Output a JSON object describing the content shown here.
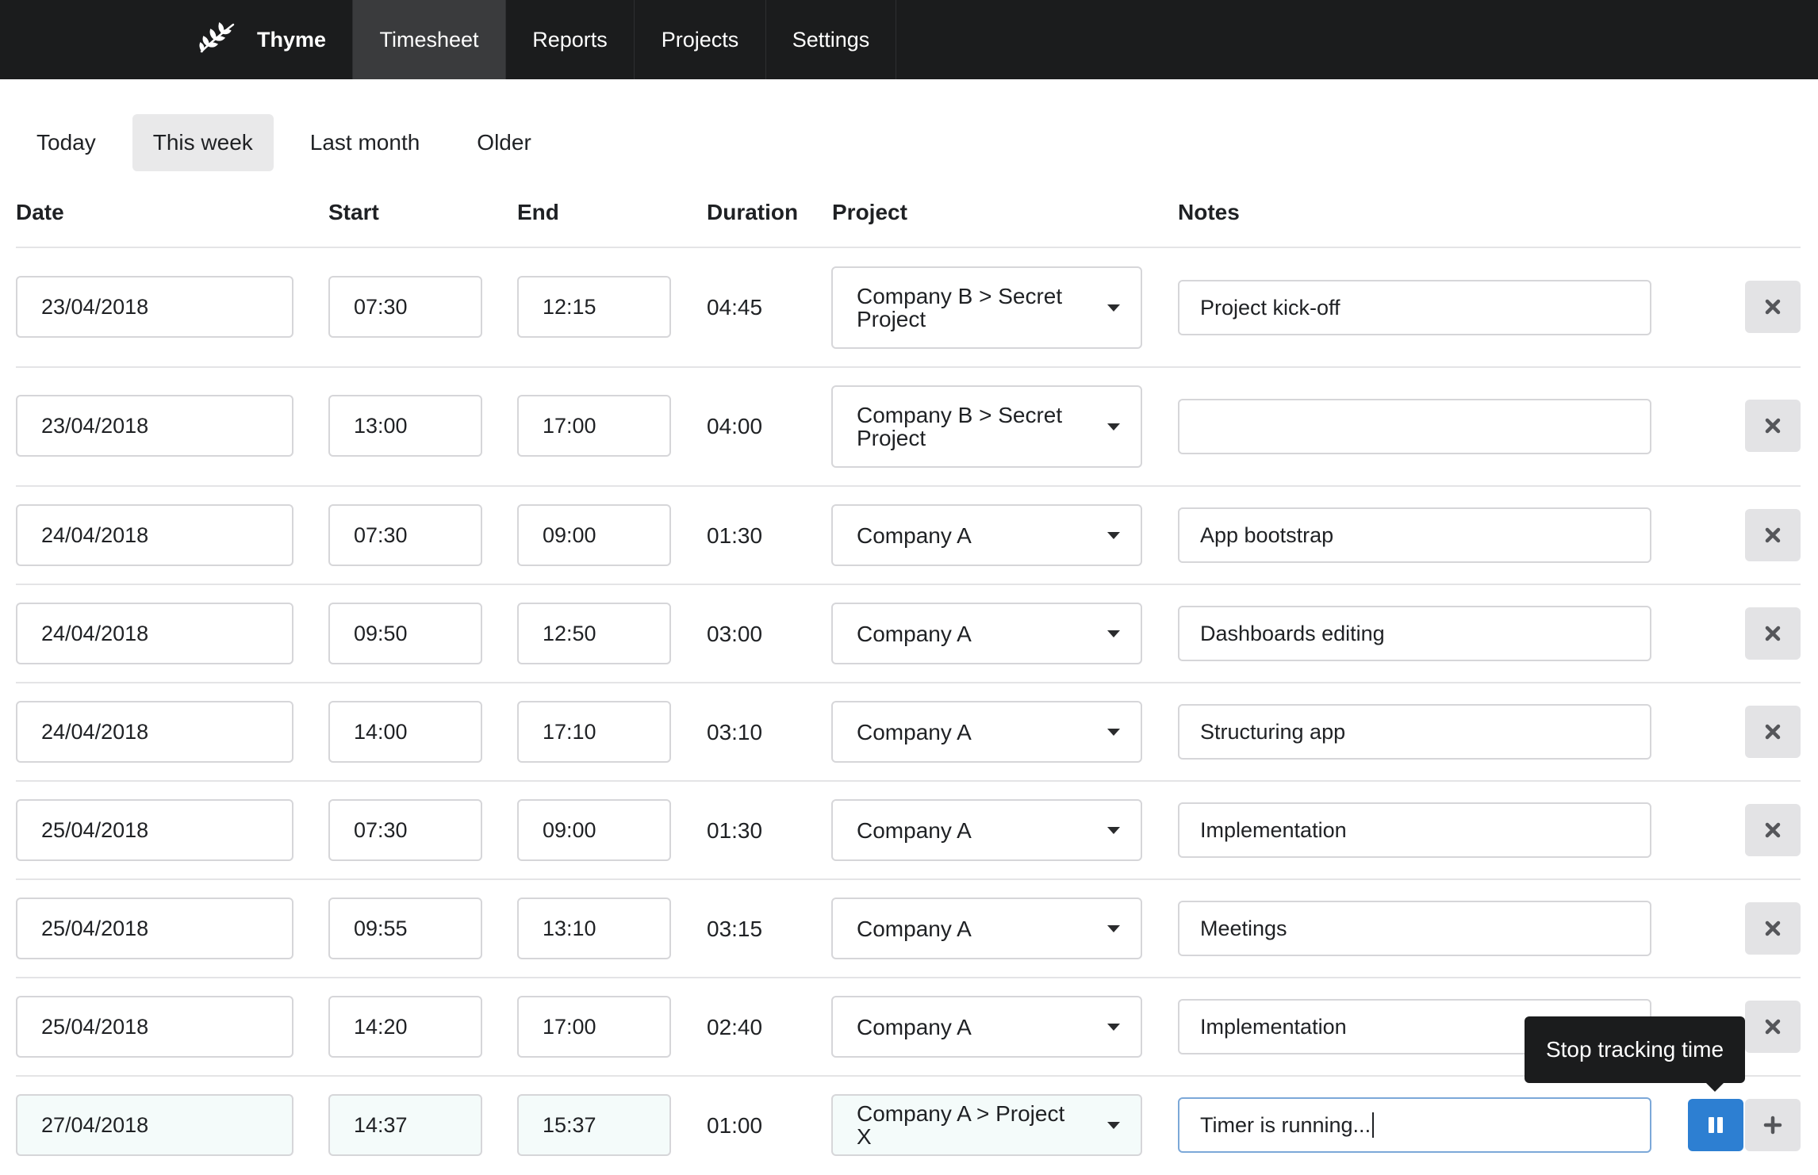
{
  "app": {
    "name": "Thyme",
    "logo_icon": "leaf-sprig-icon"
  },
  "nav": {
    "items": [
      {
        "label": "Timesheet",
        "active": true
      },
      {
        "label": "Reports",
        "active": false
      },
      {
        "label": "Projects",
        "active": false
      },
      {
        "label": "Settings",
        "active": false
      }
    ]
  },
  "filters": {
    "items": [
      {
        "label": "Today",
        "active": false
      },
      {
        "label": "This week",
        "active": true
      },
      {
        "label": "Last month",
        "active": false
      },
      {
        "label": "Older",
        "active": false
      }
    ]
  },
  "table": {
    "headers": {
      "date": "Date",
      "start": "Start",
      "end": "End",
      "duration": "Duration",
      "project": "Project",
      "notes": "Notes"
    },
    "rows": [
      {
        "date": "23/04/2018",
        "start": "07:30",
        "end": "12:15",
        "duration": "04:45",
        "project": "Company B > Secret Project",
        "notes": "Project kick-off"
      },
      {
        "date": "23/04/2018",
        "start": "13:00",
        "end": "17:00",
        "duration": "04:00",
        "project": "Company B > Secret Project",
        "notes": ""
      },
      {
        "date": "24/04/2018",
        "start": "07:30",
        "end": "09:00",
        "duration": "01:30",
        "project": "Company A",
        "notes": "App bootstrap"
      },
      {
        "date": "24/04/2018",
        "start": "09:50",
        "end": "12:50",
        "duration": "03:00",
        "project": "Company A",
        "notes": "Dashboards editing"
      },
      {
        "date": "24/04/2018",
        "start": "14:00",
        "end": "17:10",
        "duration": "03:10",
        "project": "Company A",
        "notes": "Structuring app"
      },
      {
        "date": "25/04/2018",
        "start": "07:30",
        "end": "09:00",
        "duration": "01:30",
        "project": "Company A",
        "notes": "Implementation"
      },
      {
        "date": "25/04/2018",
        "start": "09:55",
        "end": "13:10",
        "duration": "03:15",
        "project": "Company A",
        "notes": "Meetings"
      },
      {
        "date": "25/04/2018",
        "start": "14:20",
        "end": "17:00",
        "duration": "02:40",
        "project": "Company A",
        "notes": "Implementation"
      }
    ],
    "running": {
      "date": "27/04/2018",
      "start": "14:37",
      "end": "15:37",
      "duration": "01:00",
      "project": "Company A > Project X",
      "notes": "Timer is running..."
    }
  },
  "tooltip": {
    "label": "Stop tracking time"
  },
  "colors": {
    "nav_bg": "#1b1c1d",
    "nav_active": "#3a3b3d",
    "accent_blue": "#2d7fd2",
    "running_tint": "#f4fbfa",
    "button_grey": "#e3e3e5"
  }
}
